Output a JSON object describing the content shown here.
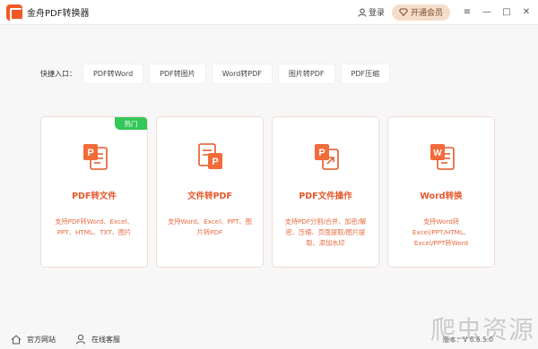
{
  "app": {
    "title": "金舟PDF转换器",
    "login_label": "登录",
    "vip_label": "开通会员"
  },
  "window_controls": {
    "menu_icon": "≡",
    "minimize_icon": "—",
    "maximize_icon": "□",
    "close_icon": "✕"
  },
  "quick": {
    "label": "快捷入口：",
    "items": [
      "PDF转Word",
      "PDF转图片",
      "Word转PDF",
      "图片转PDF",
      "PDF压缩"
    ]
  },
  "cards": [
    {
      "title": "PDF转文件",
      "desc": "支持PDF转Word、Excel、PPT、HTML、TXT、图片",
      "badge": "热门",
      "icon": "pdf-to-file-icon"
    },
    {
      "title": "文件转PDF",
      "desc": "支持Word、Excel、PPT、图片转PDF",
      "icon": "file-to-pdf-icon"
    },
    {
      "title": "PDF文件操作",
      "desc": "支持PDF分割/合并、加密/解密、压缩、页面提取/图片提取、添加水印",
      "icon": "pdf-operations-icon"
    },
    {
      "title": "Word转换",
      "desc": "支持Word转Excel/PPT/HTML、Excel/PPT转Word",
      "icon": "word-convert-icon"
    }
  ],
  "footer": {
    "website_label": "官方网站",
    "service_label": "在线客服",
    "version": "版本：V 6.6.5.0"
  },
  "watermark": "爬虫资源",
  "colors": {
    "accent": "#e4572a",
    "vip_bg": "#f5ddc9",
    "hot_badge": "#34c759"
  }
}
